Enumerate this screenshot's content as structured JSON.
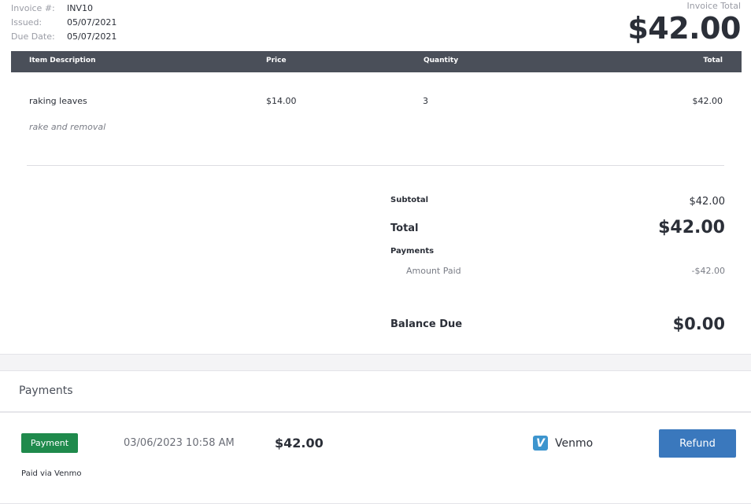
{
  "invoice": {
    "number_label": "Invoice #:",
    "number": "INV10",
    "issued_label": "Issued:",
    "issued": "05/07/2021",
    "due_label": "Due Date:",
    "due": "05/07/2021",
    "total_label": "Invoice Total",
    "total": "$42.00"
  },
  "table": {
    "headers": {
      "description": "Item Description",
      "price": "Price",
      "quantity": "Quantity",
      "total": "Total"
    },
    "rows": [
      {
        "name": "raking leaves",
        "note": "rake and removal",
        "price": "$14.00",
        "quantity": "3",
        "total": "$42.00"
      }
    ]
  },
  "summary": {
    "subtotal_label": "Subtotal",
    "subtotal": "$42.00",
    "total_label": "Total",
    "total": "$42.00",
    "payments_label": "Payments",
    "amount_paid_label": "Amount Paid",
    "amount_paid": "-$42.00",
    "balance_label": "Balance Due",
    "balance": "$0.00"
  },
  "payments": {
    "title": "Payments",
    "items": [
      {
        "badge": "Payment",
        "date": "03/06/2023 10:58 AM",
        "amount": "$42.00",
        "method_icon": "venmo-icon",
        "method": "Venmo",
        "refund_label": "Refund",
        "note": "Paid via Venmo"
      }
    ]
  },
  "colors": {
    "table_header_bg": "#4a4f59",
    "badge_green": "#1f8a4c",
    "refund_blue": "#3a78bd",
    "venmo_blue": "#3d95ce"
  }
}
